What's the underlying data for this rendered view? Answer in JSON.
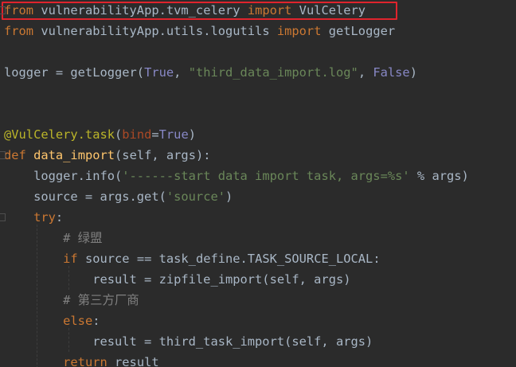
{
  "editor": {
    "theme": "darcula",
    "colors": {
      "background": "#2b2b2b",
      "keyword": "#cc7832",
      "string": "#6a8759",
      "comment": "#808080",
      "decorator": "#bbb529",
      "param": "#aa4926",
      "function": "#ffc66d",
      "constant": "#8888c6",
      "text": "#a9b7c6",
      "highlight_box": "#e0242d"
    },
    "highlighted_line_index": 0,
    "lines": [
      [
        [
          "kw",
          "from"
        ],
        [
          "plain",
          " vulnerabilityApp.tvm_celery "
        ],
        [
          "kw",
          "import"
        ],
        [
          "plain",
          " VulCelery"
        ]
      ],
      [
        [
          "kw",
          "from"
        ],
        [
          "plain",
          " vulnerabilityApp.utils.logutils "
        ],
        [
          "kw",
          "import"
        ],
        [
          "plain",
          " getLogger"
        ]
      ],
      [],
      [
        [
          "plain",
          "logger = getLogger("
        ],
        [
          "bool",
          "True"
        ],
        [
          "plain",
          ", "
        ],
        [
          "str",
          "\"third_data_import.log\""
        ],
        [
          "plain",
          ", "
        ],
        [
          "bool",
          "False"
        ],
        [
          "plain",
          ")"
        ]
      ],
      [],
      [],
      [
        [
          "dec",
          "@VulCelery.task"
        ],
        [
          "plain",
          "("
        ],
        [
          "param",
          "bind"
        ],
        [
          "plain",
          "="
        ],
        [
          "bool",
          "True"
        ],
        [
          "plain",
          ")"
        ]
      ],
      [
        [
          "kw",
          "def"
        ],
        [
          "plain",
          " "
        ],
        [
          "fn",
          "data_import"
        ],
        [
          "plain",
          "(self, args):"
        ]
      ],
      [
        [
          "plain",
          "    logger.info("
        ],
        [
          "str",
          "'------start data import task, args=%s'"
        ],
        [
          "plain",
          " % args)"
        ]
      ],
      [
        [
          "plain",
          "    source = args.get("
        ],
        [
          "str",
          "'source'"
        ],
        [
          "plain",
          ")"
        ]
      ],
      [
        [
          "plain",
          "    "
        ],
        [
          "kw",
          "try"
        ],
        [
          "plain",
          ":"
        ]
      ],
      [
        [
          "plain",
          "        "
        ],
        [
          "cmt",
          "# 绿盟"
        ]
      ],
      [
        [
          "plain",
          "        "
        ],
        [
          "kw",
          "if"
        ],
        [
          "plain",
          " source == task_define.TASK_SOURCE_LOCAL:"
        ]
      ],
      [
        [
          "plain",
          "            result = zipfile_import(self, args)"
        ]
      ],
      [
        [
          "plain",
          "        "
        ],
        [
          "cmt",
          "# 第三方厂商"
        ]
      ],
      [
        [
          "plain",
          "        "
        ],
        [
          "kw",
          "else"
        ],
        [
          "plain",
          ":"
        ]
      ],
      [
        [
          "plain",
          "            result = third_task_import(self, args)"
        ]
      ],
      [
        [
          "plain",
          "        "
        ],
        [
          "kw",
          "return"
        ],
        [
          "plain",
          " result"
        ]
      ]
    ]
  }
}
